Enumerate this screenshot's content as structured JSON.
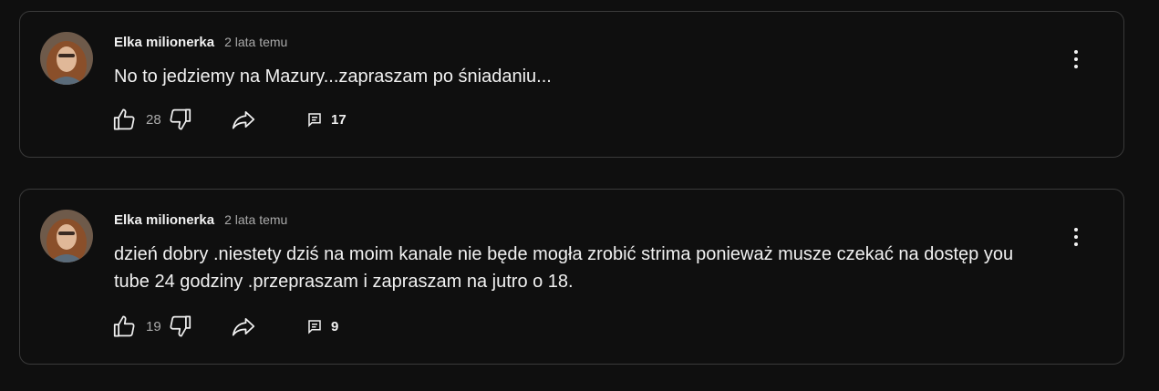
{
  "posts": [
    {
      "author": "Elka milionerka",
      "time": "2 lata temu",
      "text": "No to jedziemy na Mazury...zapraszam po śniadaniu...",
      "likes": "28",
      "replies": "17"
    },
    {
      "author": "Elka milionerka",
      "time": "2 lata temu",
      "text": "dzień dobry .niestety dziś na moim kanale nie będe mogła zrobić strima ponieważ musze czekać na dostęp you tube 24 godziny .przepraszam i zapraszam na jutro o 18.",
      "likes": "19",
      "replies": "9"
    }
  ],
  "colors": {
    "background": "#0f0f0f",
    "border": "#3a3a3a",
    "text_primary": "#f1f1f1",
    "text_secondary": "#aaaaaa"
  },
  "icons": [
    "avatar",
    "thumbs-up-icon",
    "thumbs-down-icon",
    "share-icon",
    "comment-icon",
    "more-vert-icon"
  ]
}
